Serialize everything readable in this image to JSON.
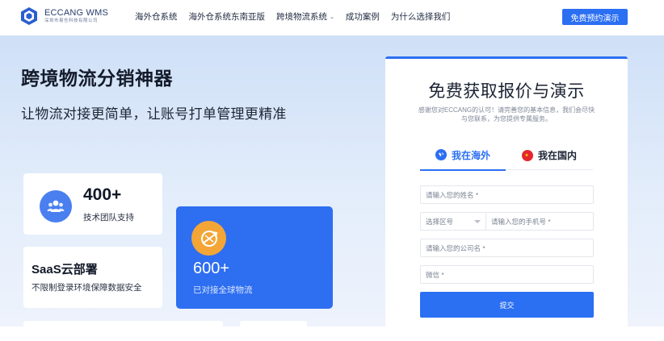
{
  "header": {
    "logo_title": "ECCANG WMS",
    "logo_sub": "深圳市易仓科技有限公司",
    "nav": [
      "海外仓系统",
      "海外仓系统东南亚版",
      "跨境物流系统",
      "成功案例",
      "为什么选择我们"
    ],
    "demo_button": "免费预约演示"
  },
  "hero": {
    "title": "跨境物流分销神器",
    "subtitle": "让物流对接更简单，让账号打单管理更精准",
    "stat1": {
      "value": "400+",
      "label": "技术团队支持",
      "icon": "team-icon"
    },
    "stat2": {
      "title": "SaaS云部署",
      "label": "不限制登录环境保障数据安全"
    },
    "stat3": {
      "value": "600+",
      "label": "已对接全球物流",
      "icon": "global-logistics-icon"
    }
  },
  "form": {
    "title": "免费获取报价与演示",
    "desc": "感谢您对ECCANG的认可！请完善您的基本信息，我们会尽快与您联系，为您提供专属服务。",
    "tabs": [
      {
        "label": "我在海外",
        "icon": "globe-icon",
        "active": true
      },
      {
        "label": "我在国内",
        "icon": "china-flag-icon",
        "active": false
      }
    ],
    "name_placeholder": "请输入您的姓名 *",
    "region_placeholder": "选择区号",
    "phone_placeholder": "请输入您的手机号 *",
    "company_placeholder": "请输入您的公司名 *",
    "wechat_placeholder": "微信 *",
    "submit": "提交"
  },
  "colors": {
    "accent": "#2b6ff2",
    "orange": "#f3a636",
    "hero_bg": "#dbe7f8"
  }
}
